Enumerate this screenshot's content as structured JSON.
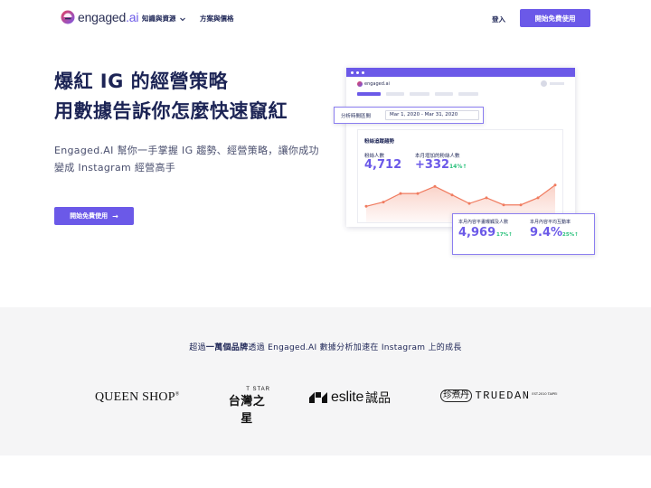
{
  "nav": {
    "logo_text": "engaged",
    "logo_suffix": ".ai",
    "links": [
      {
        "label": "知識與資源",
        "has_dropdown": true
      },
      {
        "label": "方案與價格",
        "has_dropdown": false
      }
    ],
    "login_label": "登入",
    "cta_label": "開始免費使用"
  },
  "hero": {
    "title_line1": "爆紅 IG 的經營策略",
    "title_line2": "用數據告訴你怎麼快速竄紅",
    "subtitle": "Engaged.AI 幫你一手掌握 IG 趨勢、經營策略，讓你成功變成 Instagram 經營高手",
    "cta_label": "開始免費使用",
    "cta_icon": "arrow-right-icon"
  },
  "dashboard": {
    "logo_text": "engaged.ai",
    "date_label": "分析時間區間",
    "date_range": "Mar 1, 2020 - Mar 31, 2020",
    "card_title": "粉絲追蹤趨勢",
    "followers_label": "粉絲人數",
    "followers_value": "4,712",
    "new_followers_label": "本月增加的粉絲人數",
    "new_followers_value": "+332",
    "new_followers_delta": "14%↑",
    "reach_label": "本月內容平畫曝觸及人數",
    "reach_value": "4,969",
    "reach_delta": "17%↑",
    "engagement_label": "本月內容平均互動率",
    "engagement_value": "9.4%",
    "engagement_delta": "25%↑",
    "trend_values": [
      10,
      13,
      19,
      19,
      24,
      18,
      12,
      16,
      11,
      11,
      16,
      25
    ],
    "accent_color": "#6b59e8",
    "line_color": "#f07b5f",
    "positive_color": "#27c07a"
  },
  "brands": {
    "title_prefix": "超過",
    "title_bold": "一萬個品牌",
    "title_suffix": "透過 Engaged.AI 數據分析加速在 Instagram 上的成長",
    "logos": {
      "queenshop": "QUEEN SHOP",
      "queenshop_mark": "®",
      "tstar_top": "T STAR",
      "tstar_bottom": "台灣之星",
      "eslite": "eslite",
      "eslite_cn": "誠品",
      "truedan_seal": "珍煮丹",
      "truedan": "TRUEDAN",
      "truedan_est": "EST.2010 TAIPEI"
    }
  }
}
